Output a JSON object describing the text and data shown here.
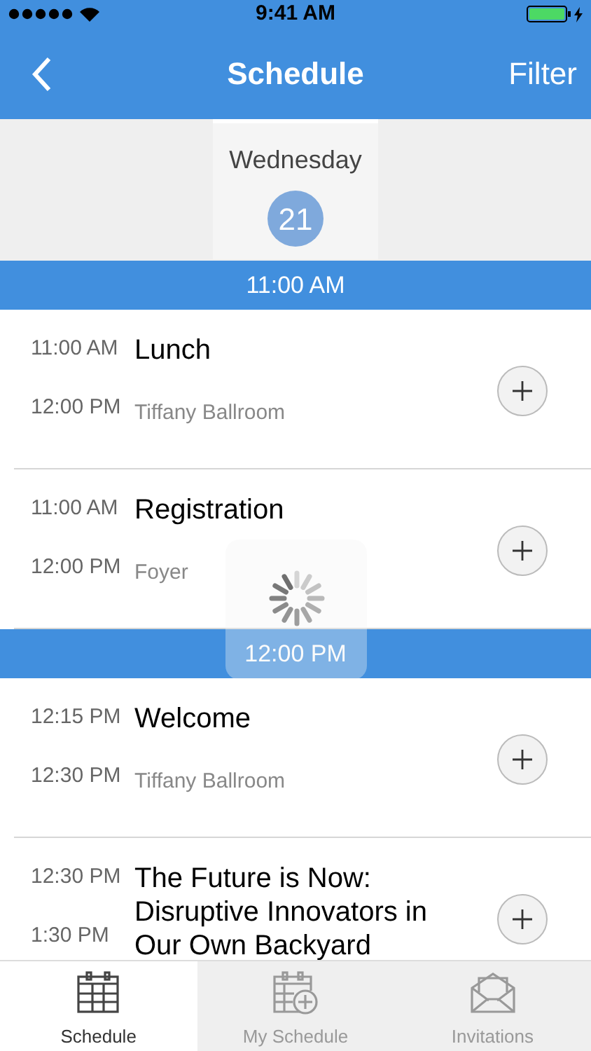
{
  "status_bar": {
    "time": "9:41 AM"
  },
  "nav": {
    "title": "Schedule",
    "filter": "Filter"
  },
  "date": {
    "weekday": "Wednesday",
    "day": "21",
    "selected": true
  },
  "sections": [
    {
      "header": "11:00 AM",
      "events": [
        {
          "start": "11:00 AM",
          "end": "12:00 PM",
          "title": "Lunch",
          "location": "Tiffany Ballroom"
        },
        {
          "start": "11:00 AM",
          "end": "12:00 PM",
          "title": "Registration",
          "location": "Foyer"
        }
      ]
    },
    {
      "header": "12:00 PM",
      "events": [
        {
          "start": "12:15 PM",
          "end": "12:30 PM",
          "title": "Welcome",
          "location": "Tiffany Ballroom"
        },
        {
          "start": "12:30 PM",
          "end": "1:30 PM",
          "title": "The Future is Now: Disruptive Innovators in Our Own Backyard"
        }
      ]
    }
  ],
  "loading": true,
  "tabs": [
    {
      "label": "Schedule",
      "selected": true,
      "kind": "calendar"
    },
    {
      "label": "My Schedule",
      "selected": false,
      "kind": "calendar-add"
    },
    {
      "label": "Invitations",
      "selected": false,
      "kind": "envelope"
    }
  ]
}
